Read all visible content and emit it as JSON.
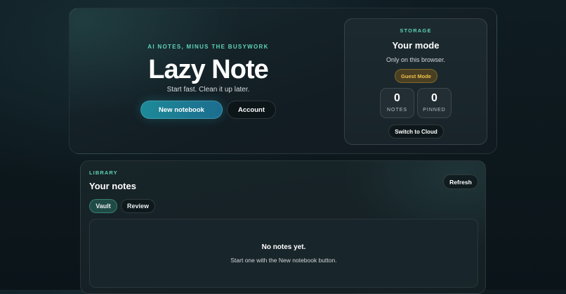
{
  "hero": {
    "eyebrow": "AI NOTES, MINUS THE BUSYWORK",
    "title": "Lazy Note",
    "tagline": "Start fast. Clean it up later.",
    "new_notebook_label": "New notebook",
    "account_label": "Account"
  },
  "storage": {
    "eyebrow": "STORAGE",
    "title": "Your mode",
    "subtitle": "Only on this browser.",
    "mode_badge": "Guest Mode",
    "stats": {
      "notes": {
        "value": "0",
        "label": "NOTES"
      },
      "pinned": {
        "value": "0",
        "label": "PINNED"
      }
    },
    "switch_label": "Switch to Cloud"
  },
  "library": {
    "eyebrow": "LIBRARY",
    "title": "Your notes",
    "refresh_label": "Refresh",
    "tabs": {
      "vault": "Vault",
      "review": "Review"
    },
    "active_tab": "Vault",
    "empty_title": "No notes yet.",
    "empty_subtitle": "Start one with the New notebook button."
  },
  "colors": {
    "accent": "#5fd3b5",
    "primary_button": "#1d8a98",
    "guest_badge_text": "#f0c04a",
    "background": "#0f1c22"
  }
}
